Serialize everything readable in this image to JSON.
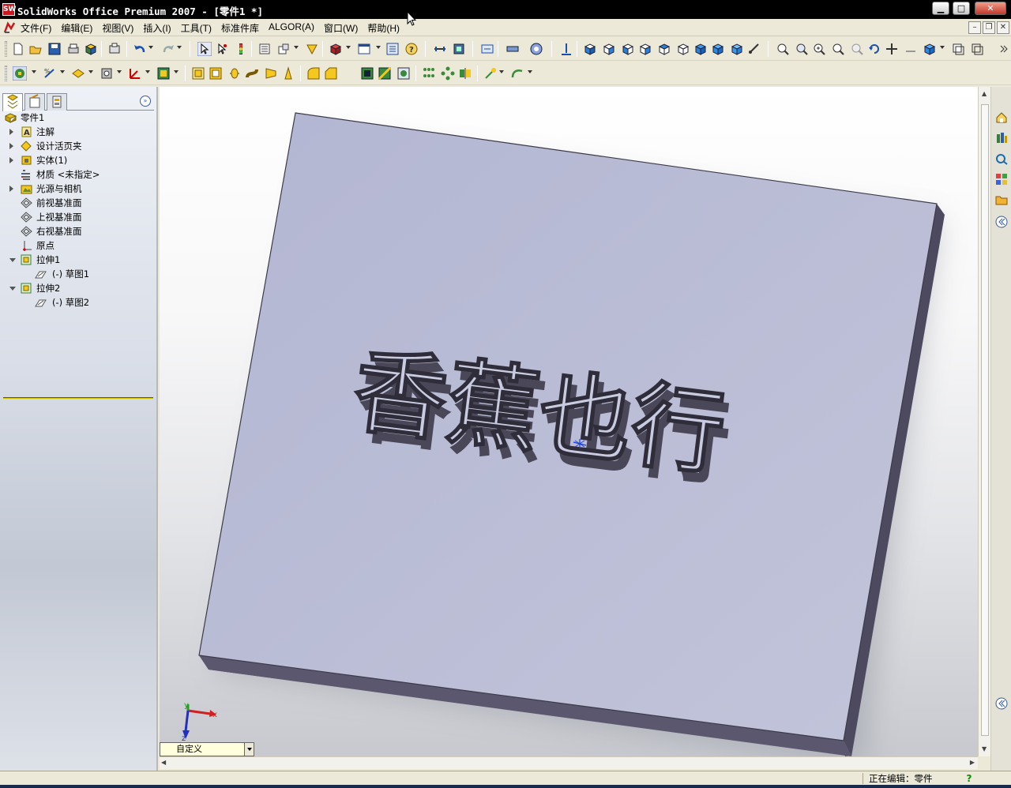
{
  "window": {
    "app_icon_text": "SW",
    "title": "SolidWorks Office Premium 2007 - [零件1 *]",
    "buttons": {
      "minimize": "▁",
      "maximize": "□",
      "close": "✕"
    }
  },
  "menubar": {
    "items": [
      "文件(F)",
      "编辑(E)",
      "视图(V)",
      "插入(I)",
      "工具(T)",
      "标准件库",
      "ALGOR(A)",
      "窗口(W)",
      "帮助(H)"
    ],
    "mdi_buttons": [
      "–",
      "❐",
      "✕"
    ]
  },
  "feature_tree": {
    "root": "零件1",
    "items": [
      {
        "label": "注解",
        "icon": "annotations-icon",
        "expander": "plus"
      },
      {
        "label": "设计活页夹",
        "icon": "design-binder-icon",
        "expander": "plus"
      },
      {
        "label": "实体(1)",
        "icon": "solid-bodies-icon",
        "expander": "plus"
      },
      {
        "label": "材质 <未指定>",
        "icon": "material-icon",
        "expander": "none"
      },
      {
        "label": "光源与相机",
        "icon": "lights-cameras-icon",
        "expander": "plus"
      },
      {
        "label": "前视基准面",
        "icon": "plane-icon",
        "expander": "none"
      },
      {
        "label": "上视基准面",
        "icon": "plane-icon",
        "expander": "none"
      },
      {
        "label": "右视基准面",
        "icon": "plane-icon",
        "expander": "none"
      },
      {
        "label": "原点",
        "icon": "origin-icon",
        "expander": "none"
      },
      {
        "label": "拉伸1",
        "icon": "extrude-icon",
        "expander": "minus"
      },
      {
        "label": "(-) 草图1",
        "icon": "sketch-icon",
        "expander": "none",
        "child": true
      },
      {
        "label": "拉伸2",
        "icon": "extrude-icon",
        "expander": "minus"
      },
      {
        "label": "(-) 草图2",
        "icon": "sketch-icon",
        "expander": "none",
        "child": true
      }
    ]
  },
  "viewport": {
    "model_text": "香蕉也行",
    "view_orientation": "自定义",
    "triad": {
      "x": "x",
      "y": "y",
      "z": "z"
    }
  },
  "statusbar": {
    "status": "正在编辑：零件",
    "help": "?"
  },
  "colors": {
    "plate_top": "#b8bad5",
    "plate_side": "#57546a",
    "text_face": "#c9cbe0",
    "text_wall": "#4a4858"
  }
}
